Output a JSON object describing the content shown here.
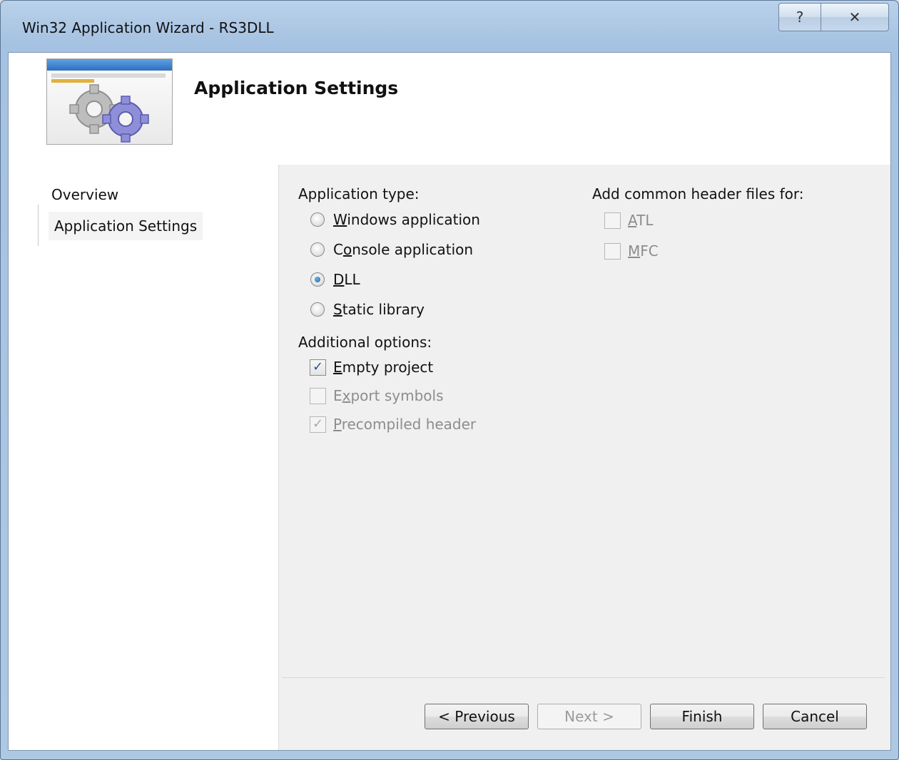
{
  "window": {
    "title": "Win32 Application Wizard - RS3DLL",
    "help_glyph": "?",
    "close_glyph": "✕"
  },
  "header": {
    "title": "Application Settings"
  },
  "sidebar": {
    "items": [
      {
        "label": "Overview"
      },
      {
        "label": "Application Settings"
      }
    ]
  },
  "application_type": {
    "label": "Application type:",
    "options": [
      {
        "label": "Windows application",
        "selected": false
      },
      {
        "label": "Console application",
        "selected": false
      },
      {
        "label": "DLL",
        "selected": true
      },
      {
        "label": "Static library",
        "selected": false
      }
    ]
  },
  "additional_options": {
    "label": "Additional options:",
    "options": [
      {
        "label": "Empty project",
        "checked": true,
        "enabled": true
      },
      {
        "label": "Export symbols",
        "checked": false,
        "enabled": false
      },
      {
        "label": "Precompiled header",
        "checked": true,
        "enabled": false
      }
    ]
  },
  "common_headers": {
    "label": "Add common header files for:",
    "options": [
      {
        "label": "ATL",
        "checked": false,
        "enabled": false
      },
      {
        "label": "MFC",
        "checked": false,
        "enabled": false
      }
    ]
  },
  "buttons": {
    "previous": "< Previous",
    "next": "Next >",
    "finish": "Finish",
    "cancel": "Cancel"
  },
  "colors": {
    "frame": "#a6c2e2",
    "client_bg": "#f0f0f0",
    "check_mark": "#2b4fa0"
  }
}
